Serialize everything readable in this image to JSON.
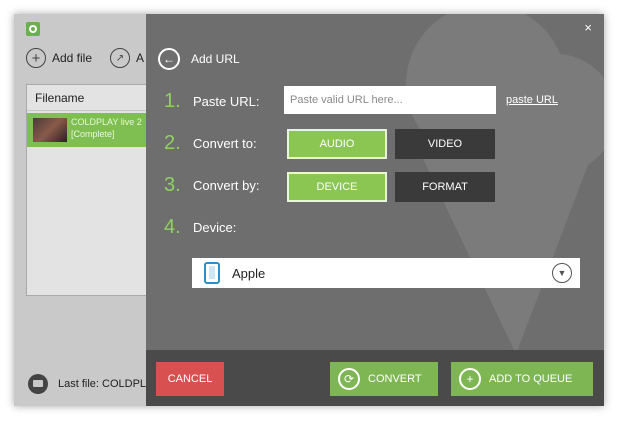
{
  "app": {
    "toolbar": {
      "add_file": "Add file",
      "share_partial": "A"
    },
    "file_list": {
      "header": "Filename",
      "rows": [
        {
          "name": "COLDPLAY live 2",
          "status": "[Complete]"
        }
      ]
    },
    "last_file": "Last file: COLDPL"
  },
  "dialog": {
    "close": "×",
    "back_icon": "←",
    "title": "Add URL",
    "steps": [
      {
        "num": "1.",
        "label": "Paste URL:"
      },
      {
        "num": "2.",
        "label": "Convert to:"
      },
      {
        "num": "3.",
        "label": "Convert by:"
      },
      {
        "num": "4.",
        "label": "Device:"
      }
    ],
    "url_placeholder": "Paste valid URL here...",
    "paste_link": "paste URL",
    "convert_to": {
      "audio": "AUDIO",
      "video": "VIDEO",
      "selected": "AUDIO"
    },
    "convert_by": {
      "device": "DEVICE",
      "format": "FORMAT",
      "selected": "DEVICE"
    },
    "device": {
      "selected": "Apple"
    },
    "buttons": {
      "cancel": "CANCEL",
      "convert": "CONVERT",
      "add_to_queue": "ADD TO QUEUE"
    }
  },
  "colors": {
    "accent_green": "#8bc653",
    "cancel_red": "#d85050",
    "overlay_gray": "#6e6e6e"
  }
}
